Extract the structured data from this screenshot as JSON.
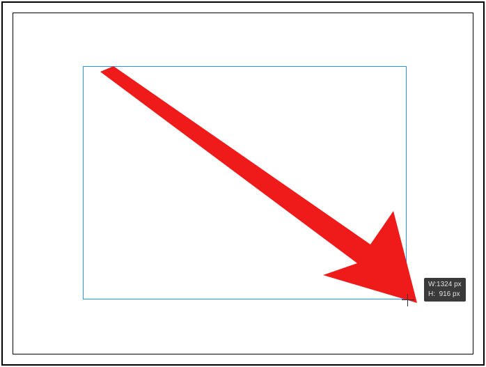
{
  "shape": {
    "outline_color": "#2196f3",
    "type": "rectangle"
  },
  "arrow": {
    "color": "#ef1a1a"
  },
  "tooltip": {
    "width_label": "W:",
    "width_value": "1324 px",
    "height_label": "H:",
    "height_value": "916 px"
  }
}
